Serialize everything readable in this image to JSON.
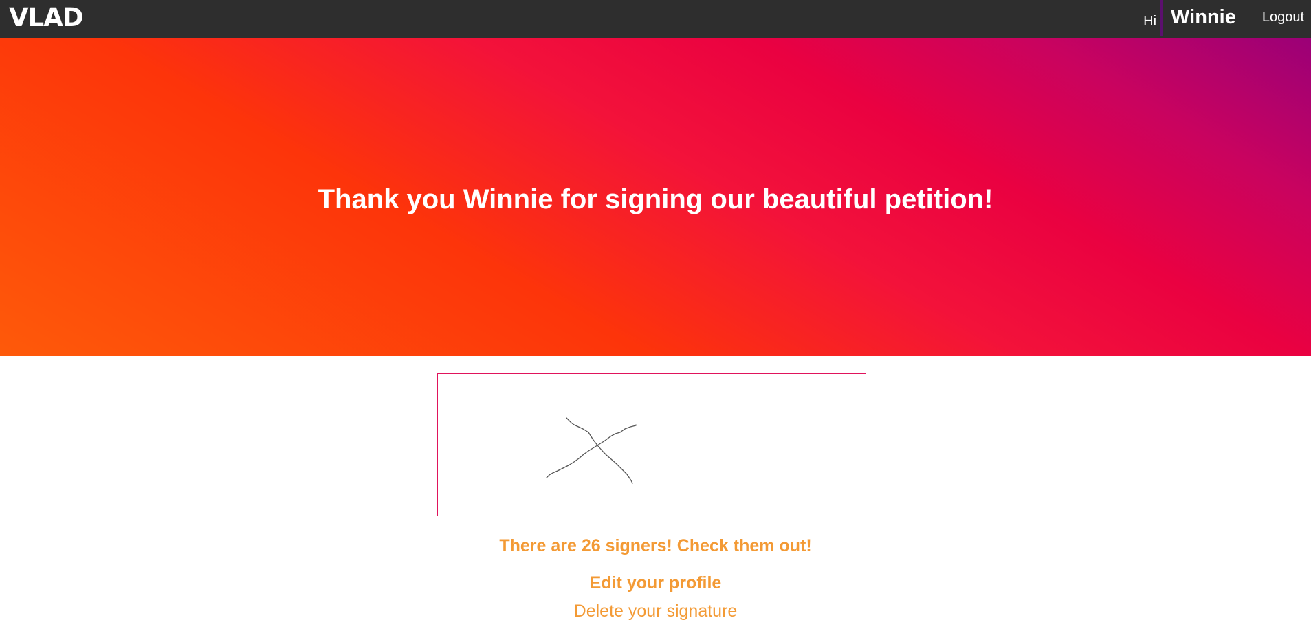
{
  "header": {
    "logo": "VLAD",
    "greeting": "Hi",
    "username": "Winnie",
    "logout_label": "Logout"
  },
  "hero": {
    "title": "Thank you Winnie for signing our beautiful petition!"
  },
  "signature": {
    "description": "signature-drawing"
  },
  "links": {
    "signers": "There are 26 signers! Check them out!",
    "edit_profile": "Edit your profile",
    "delete_signature": "Delete your signature"
  },
  "colors": {
    "topbar": "#2e2e2e",
    "accent_link": "#f39a35",
    "signature_border": "#e0145c",
    "hero_start": "#fe5a0a",
    "hero_end": "#9b0077"
  }
}
